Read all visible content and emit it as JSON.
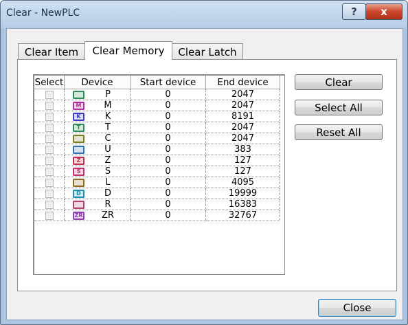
{
  "window": {
    "title": "Clear - NewPLC",
    "help_label": "?",
    "close_label": "x"
  },
  "tabs": [
    {
      "label": "Clear Item"
    },
    {
      "label": "Clear Memory"
    },
    {
      "label": "Clear Latch"
    }
  ],
  "table": {
    "headers": {
      "select": "Select",
      "device": "Device",
      "start": "Start device",
      "end": "End device"
    },
    "rows": [
      {
        "device": "P",
        "start": "0",
        "end": "2047",
        "icon_color": "#2e8b57",
        "icon_text": ""
      },
      {
        "device": "M",
        "start": "0",
        "end": "2047",
        "icon_color": "#b03098",
        "icon_text": "M"
      },
      {
        "device": "K",
        "start": "0",
        "end": "8191",
        "icon_color": "#3d3dbf",
        "icon_text": "K"
      },
      {
        "device": "T",
        "start": "0",
        "end": "2047",
        "icon_color": "#2e8b57",
        "icon_text": "T"
      },
      {
        "device": "C",
        "start": "0",
        "end": "2047",
        "icon_color": "#7a7a20",
        "icon_text": ""
      },
      {
        "device": "U",
        "start": "0",
        "end": "383",
        "icon_color": "#3070b0",
        "icon_text": ""
      },
      {
        "device": "Z",
        "start": "0",
        "end": "127",
        "icon_color": "#c03050",
        "icon_text": "Z"
      },
      {
        "device": "S",
        "start": "0",
        "end": "127",
        "icon_color": "#c03070",
        "icon_text": "S"
      },
      {
        "device": "L",
        "start": "0",
        "end": "4095",
        "icon_color": "#8a6a20",
        "icon_text": ""
      },
      {
        "device": "D",
        "start": "0",
        "end": "19999",
        "icon_color": "#1f8fb0",
        "icon_text": "D"
      },
      {
        "device": "R",
        "start": "0",
        "end": "16383",
        "icon_color": "#b04070",
        "icon_text": ""
      },
      {
        "device": "ZR",
        "start": "0",
        "end": "32767",
        "icon_color": "#9040b0",
        "icon_text": "ZR"
      }
    ]
  },
  "buttons": {
    "clear": "Clear",
    "select_all": "Select All",
    "reset_all": "Reset All",
    "close": "Close"
  }
}
